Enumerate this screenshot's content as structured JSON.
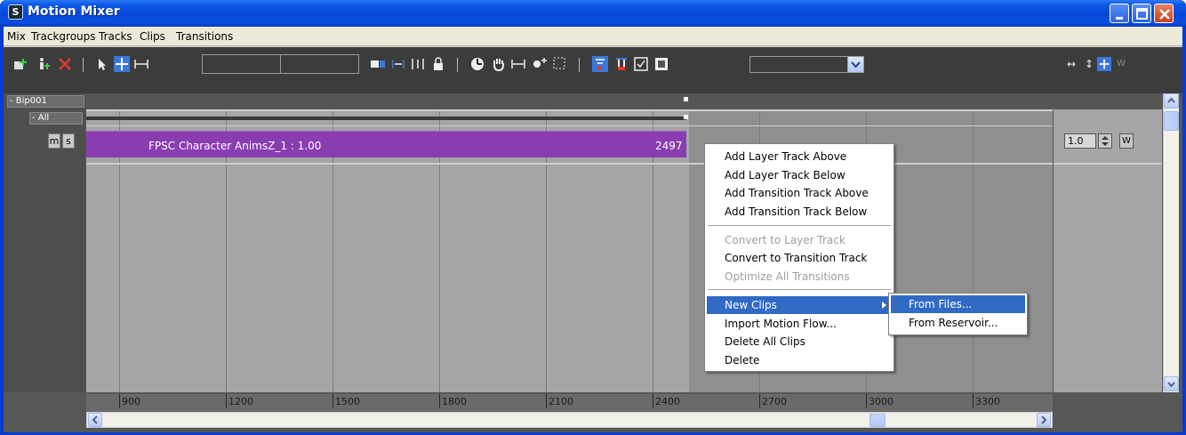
{
  "window": {
    "title": "Motion Mixer",
    "app_icon_glyph": "S",
    "controls": [
      "minimize",
      "maximize",
      "close"
    ]
  },
  "menubar": {
    "items": [
      "Mix",
      "Trackgroups",
      "Tracks",
      "Clips",
      "Transitions"
    ]
  },
  "toolbar": {
    "right_controls": [
      "↔",
      "↕",
      "W"
    ]
  },
  "tracks": {
    "trackgroup_label": "Bip001",
    "all_label": "All",
    "mute_label": "m",
    "solo_label": "s",
    "clip_label": "FPSC Character AnimsZ_1 : 1.00",
    "clip_end_frame": "2497",
    "weight_value": "1.0",
    "weight_toggle": "W"
  },
  "ruler": {
    "ticks": [
      "900",
      "1200",
      "1500",
      "1800",
      "2100",
      "2400",
      "2700",
      "3000",
      "3300"
    ]
  },
  "context_menu": {
    "items": [
      {
        "label": "Add Layer Track Above",
        "enabled": true
      },
      {
        "label": "Add Layer Track Below",
        "enabled": true
      },
      {
        "label": "Add Transition Track Above",
        "enabled": true
      },
      {
        "label": "Add Transition Track Below",
        "enabled": true
      },
      {
        "label": "Convert to Layer Track",
        "enabled": false
      },
      {
        "label": "Convert to Transition Track",
        "enabled": true
      },
      {
        "label": "Optimize All Transitions",
        "enabled": false
      },
      {
        "label": "New Clips",
        "enabled": true,
        "selected": true,
        "has_submenu": true
      },
      {
        "label": "Import Motion Flow...",
        "enabled": true
      },
      {
        "label": "Delete All Clips",
        "enabled": true
      },
      {
        "label": "Delete",
        "enabled": true
      }
    ]
  },
  "submenu": {
    "items": [
      {
        "label": "From Files...",
        "selected": true
      },
      {
        "label": "From Reservoir...",
        "selected": false
      }
    ]
  },
  "colors": {
    "clip": "#8a3db1",
    "selection": "#316ac5",
    "titlebar": "#0647d8"
  }
}
